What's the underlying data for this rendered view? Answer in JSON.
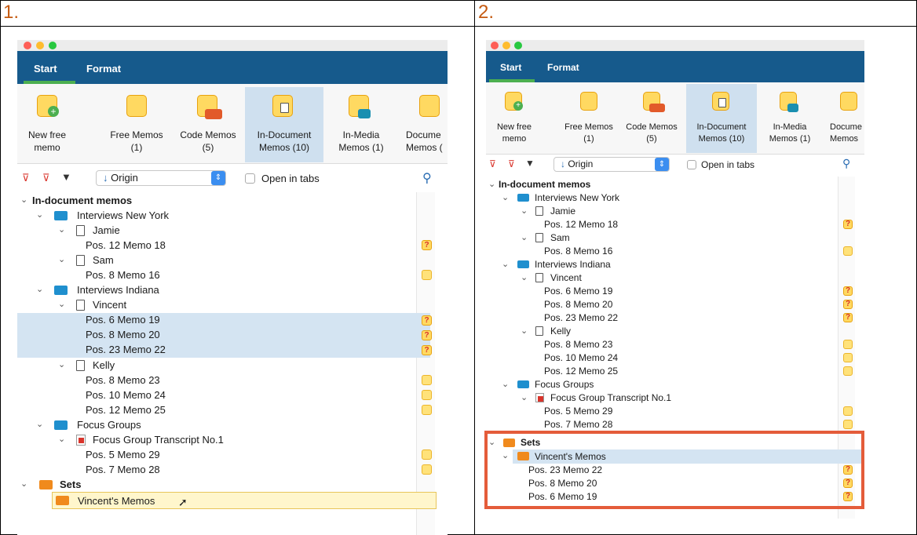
{
  "steps": [
    "1.",
    "2."
  ],
  "ribbon": {
    "tabs": [
      "Start",
      "Format"
    ],
    "buttons": [
      {
        "name": "New free memo",
        "line1": "New free",
        "line2": "memo"
      },
      {
        "name": "Free Memos",
        "line1": "Free Memos",
        "line2": "(1)"
      },
      {
        "name": "Code Memos",
        "line1": "Code Memos",
        "line2": "(5)"
      },
      {
        "name": "In-Document Memos",
        "line1": "In-Document",
        "line2": "Memos (10)"
      },
      {
        "name": "In-Media Memos",
        "line1": "In-Media",
        "line2": "Memos (1)"
      },
      {
        "name": "Document Memos",
        "line1": "Docume",
        "line2": "Memos ("
      },
      {
        "name": "Document Memos",
        "line1": "Docume",
        "line2": "Memos"
      }
    ]
  },
  "toolbar": {
    "sort_label": "Origin",
    "sort_arrow": "↓",
    "open_in_tabs": "Open in tabs"
  },
  "tree": {
    "root": "In-document memos",
    "interviews_ny": "Interviews New York",
    "jamie": "Jamie",
    "jamie_memo": "Pos. 12  Memo 18",
    "sam": "Sam",
    "sam_memo": "Pos. 8  Memo 16",
    "interviews_in": "Interviews Indiana",
    "vincent": "Vincent",
    "vincent_memos": [
      "Pos. 6  Memo 19",
      "Pos. 8  Memo 20",
      "Pos. 23  Memo 22"
    ],
    "kelly": "Kelly",
    "kelly_memos": [
      "Pos. 8  Memo 23",
      "Pos. 10  Memo 24",
      "Pos. 12  Memo 25"
    ],
    "focus_groups": "Focus Groups",
    "fg_transcript": "Focus Group Transcript No.1",
    "fg_memos": [
      "Pos. 5  Memo 29",
      "Pos. 7  Memo 28"
    ],
    "sets": "Sets",
    "vincents_set": "Vincent's Memos",
    "set_memos": [
      "Pos. 23  Memo 22",
      "Pos. 8  Memo 20",
      "Pos. 6  Memo 19"
    ]
  },
  "icons": {
    "question": "?",
    "chevron_down": "⌄",
    "search": "⚲"
  },
  "colors": {
    "accent": "#165a8c",
    "selection": "#d4e4f2",
    "highlight": "#e45c3a",
    "memo": "#ffd961"
  }
}
